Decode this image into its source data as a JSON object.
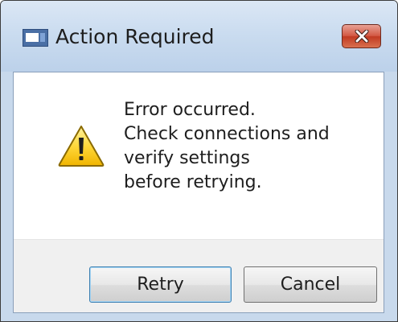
{
  "window": {
    "title": "Action Required",
    "app_icon": "window-app-icon",
    "close_icon": "close-icon"
  },
  "message": {
    "icon": "warning-icon",
    "lines": [
      "Error occurred.",
      "Check connections and",
      "verify settings",
      "before retrying."
    ]
  },
  "buttons": {
    "retry_label": "Retry",
    "cancel_label": "Cancel"
  },
  "colors": {
    "titlebar": "#c9dbef",
    "close_button": "#c13a22",
    "footer": "#f0f0f0",
    "default_button_border": "#3c7fb1"
  }
}
